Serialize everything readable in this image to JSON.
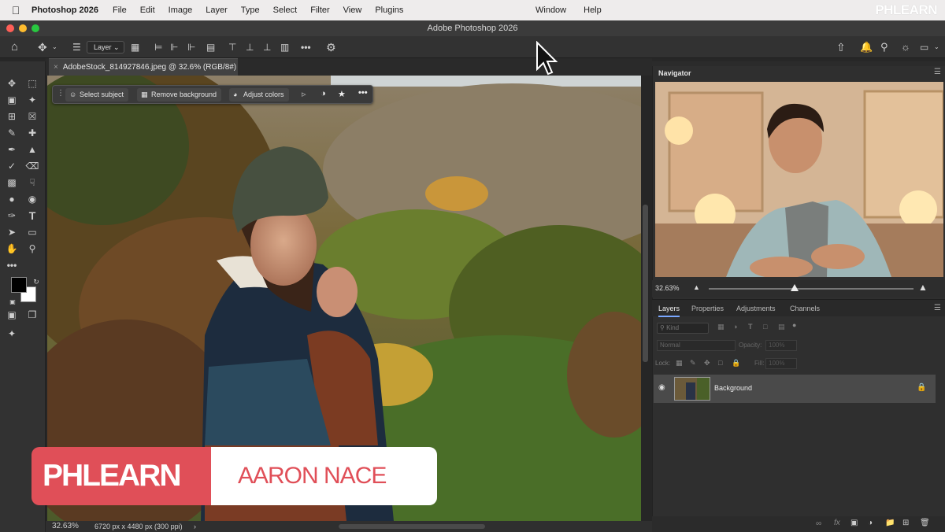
{
  "menubar": {
    "app_name": "Photoshop 2026",
    "items": [
      "File",
      "Edit",
      "Image",
      "Layer",
      "Type",
      "Select",
      "Filter",
      "View",
      "Plugins"
    ],
    "right_items": [
      "Window",
      "Help"
    ],
    "brand": "PHLEARN"
  },
  "window": {
    "title": "Adobe Photoshop 2026"
  },
  "options_bar": {
    "layer_select": "Layer"
  },
  "document": {
    "tab_title": "AdobeStock_814927846.jpeg @ 32.6% (RGB/8#)"
  },
  "contextual_taskbar": {
    "select_subject": "Select subject",
    "remove_background": "Remove background",
    "adjust_colors": "Adjust colors"
  },
  "status": {
    "zoom": "32.63%",
    "doc_info": "6720 px x 4480 px (300 ppi)"
  },
  "navigator": {
    "title": "Navigator",
    "zoom": "32.63%"
  },
  "layers_panel": {
    "tabs": [
      "Layers",
      "Properties",
      "Adjustments",
      "Channels"
    ],
    "kind_placeholder": "Kind",
    "blend_mode": "Normal",
    "opacity_label": "Opacity:",
    "opacity_value": "100%",
    "lock_label": "Lock:",
    "fill_label": "Fill:",
    "fill_value": "100%",
    "layers": [
      {
        "name": "Background"
      }
    ]
  },
  "lower_third": {
    "brand": "PHLEARN",
    "name": "AARON NACE"
  },
  "colors": {
    "accent": "#e04f58",
    "panel_bg": "#2f2f2f",
    "tab_underline": "#7aa7ff"
  }
}
